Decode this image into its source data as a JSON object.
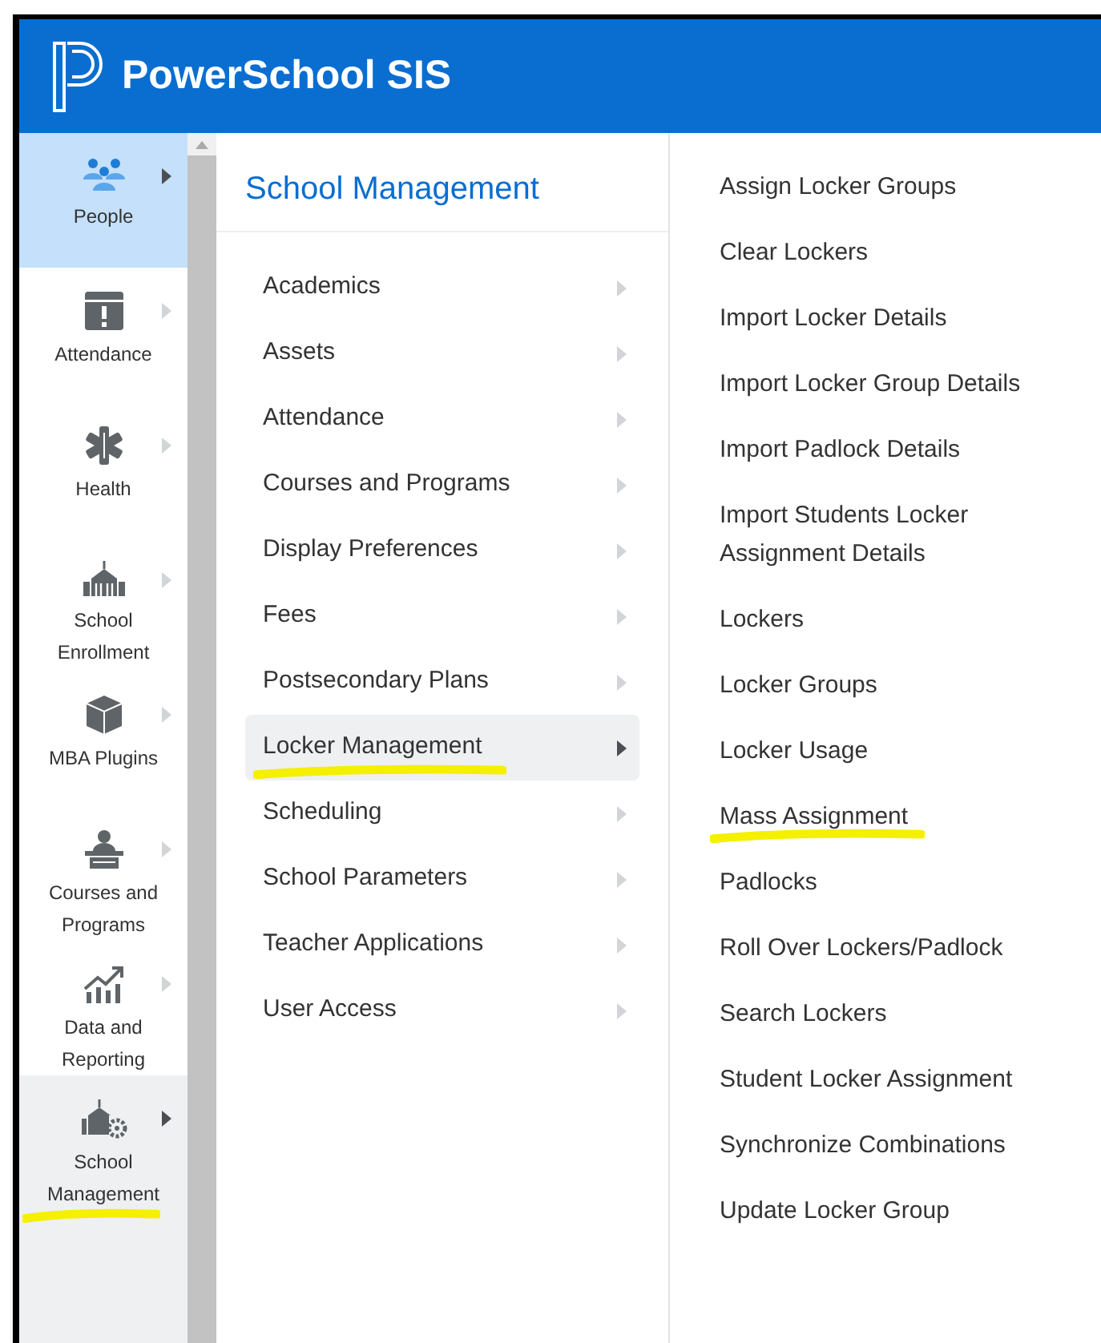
{
  "header": {
    "title": "PowerSchool SIS"
  },
  "sidebar": {
    "items": [
      {
        "label": "People",
        "selected": true,
        "open": false,
        "highlighted": false
      },
      {
        "label": "Attendance",
        "selected": false,
        "open": false,
        "highlighted": false
      },
      {
        "label": "Health",
        "selected": false,
        "open": false,
        "highlighted": false
      },
      {
        "label": "School Enrollment",
        "selected": false,
        "open": false,
        "highlighted": false
      },
      {
        "label": "MBA Plugins",
        "selected": false,
        "open": false,
        "highlighted": false
      },
      {
        "label": "Courses and Programs",
        "selected": false,
        "open": false,
        "highlighted": false
      },
      {
        "label": "Data and Reporting",
        "selected": false,
        "open": false,
        "highlighted": false
      },
      {
        "label": "School Management",
        "selected": false,
        "open": true,
        "highlighted": true
      }
    ]
  },
  "menu": {
    "title": "School Management",
    "items": [
      {
        "label": "Academics",
        "selected": false,
        "highlighted": false
      },
      {
        "label": "Assets",
        "selected": false,
        "highlighted": false
      },
      {
        "label": "Attendance",
        "selected": false,
        "highlighted": false
      },
      {
        "label": "Courses and Programs",
        "selected": false,
        "highlighted": false
      },
      {
        "label": "Display Preferences",
        "selected": false,
        "highlighted": false
      },
      {
        "label": "Fees",
        "selected": false,
        "highlighted": false
      },
      {
        "label": "Postsecondary Plans",
        "selected": false,
        "highlighted": false
      },
      {
        "label": "Locker Management",
        "selected": true,
        "highlighted": true
      },
      {
        "label": "Scheduling",
        "selected": false,
        "highlighted": false
      },
      {
        "label": "School Parameters",
        "selected": false,
        "highlighted": false
      },
      {
        "label": "Teacher Applications",
        "selected": false,
        "highlighted": false
      },
      {
        "label": "User Access",
        "selected": false,
        "highlighted": false
      }
    ]
  },
  "submenu": {
    "items": [
      {
        "label": "Assign Locker Groups",
        "highlighted": false
      },
      {
        "label": "Clear Lockers",
        "highlighted": false
      },
      {
        "label": "Import Locker Details",
        "highlighted": false
      },
      {
        "label": "Import Locker Group Details",
        "highlighted": false
      },
      {
        "label": "Import Padlock Details",
        "highlighted": false
      },
      {
        "label": "Import Students Locker Assignment Details",
        "highlighted": false
      },
      {
        "label": "Lockers",
        "highlighted": false
      },
      {
        "label": "Locker Groups",
        "highlighted": false
      },
      {
        "label": "Locker Usage",
        "highlighted": false
      },
      {
        "label": "Mass Assignment",
        "highlighted": true
      },
      {
        "label": "Padlocks",
        "highlighted": false
      },
      {
        "label": "Roll Over Lockers/Padlock",
        "highlighted": false
      },
      {
        "label": "Search Lockers",
        "highlighted": false
      },
      {
        "label": "Student Locker Assignment",
        "highlighted": false
      },
      {
        "label": "Synchronize Combinations",
        "highlighted": false
      },
      {
        "label": "Update Locker Group",
        "highlighted": false
      }
    ]
  }
}
